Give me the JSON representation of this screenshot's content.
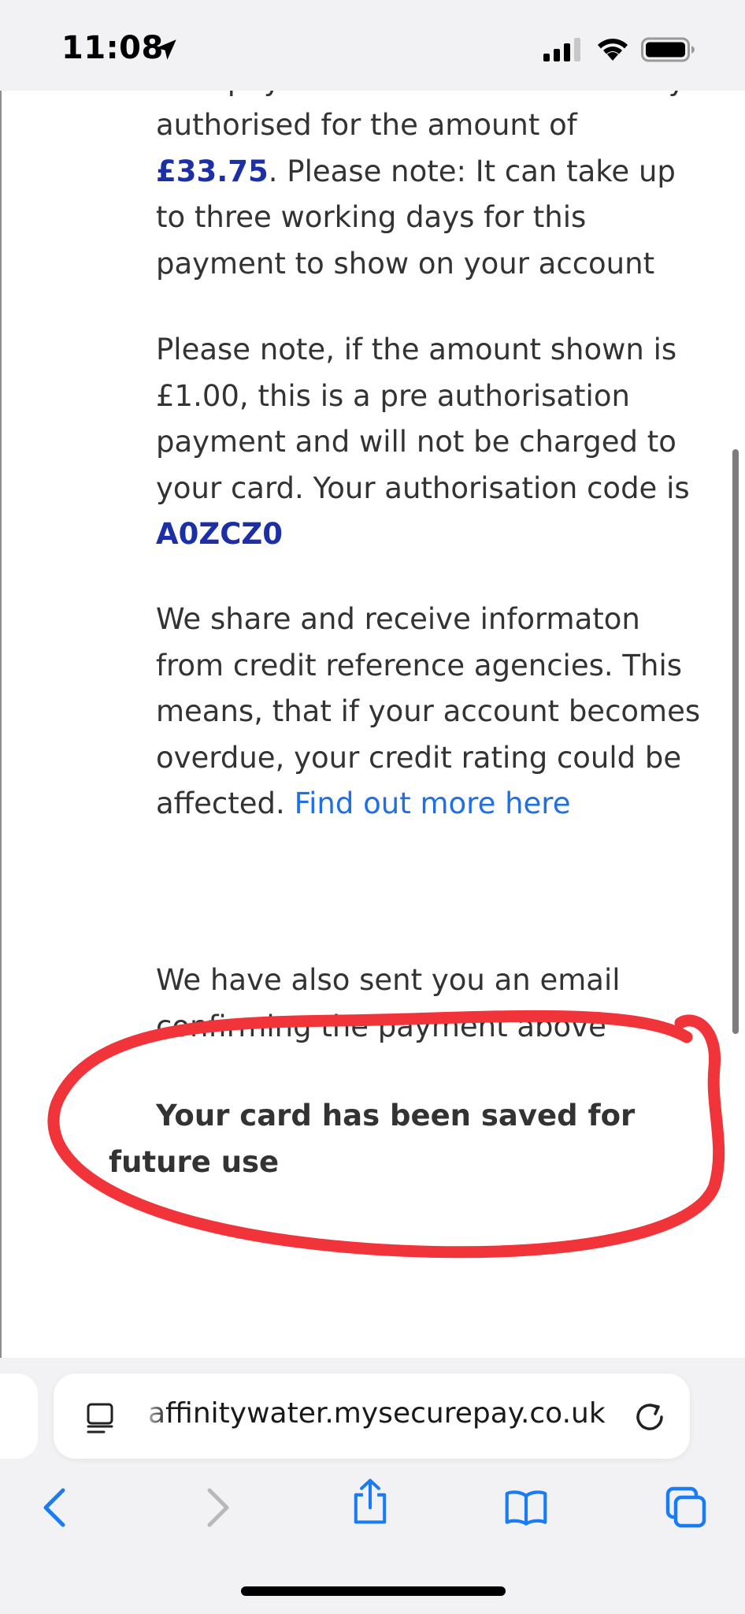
{
  "status_bar": {
    "time": "11:08"
  },
  "content": {
    "partial_top_line": "Your payment has been successfully",
    "para1": {
      "before_amount": "authorised for the amount of ",
      "amount": "£33.75",
      "after_amount": ". Please note: It can take up to three working days for this payment to show on your account"
    },
    "para2": {
      "text": "Please note, if the amount shown is £1.00, this is a pre authorisation payment and will not be charged to your card. Your authorisation code is ",
      "code": "A0ZCZ0"
    },
    "para3": {
      "text": "We share and receive informaton from credit reference agencies. This means, that if your account becomes overdue, your credit rating could be affected. ",
      "link": "Find out more here"
    },
    "para4": "We have also sent you an email confirming the payment above",
    "saved_notice": "Your card has been saved for future use"
  },
  "browser": {
    "url": "affinitywater.mysecurepay.co.uk"
  },
  "colors": {
    "amount": "#1c2fa6",
    "link": "#1f6fe5",
    "annotation": "#f0343a",
    "ios_blue": "#1a7cf5"
  }
}
